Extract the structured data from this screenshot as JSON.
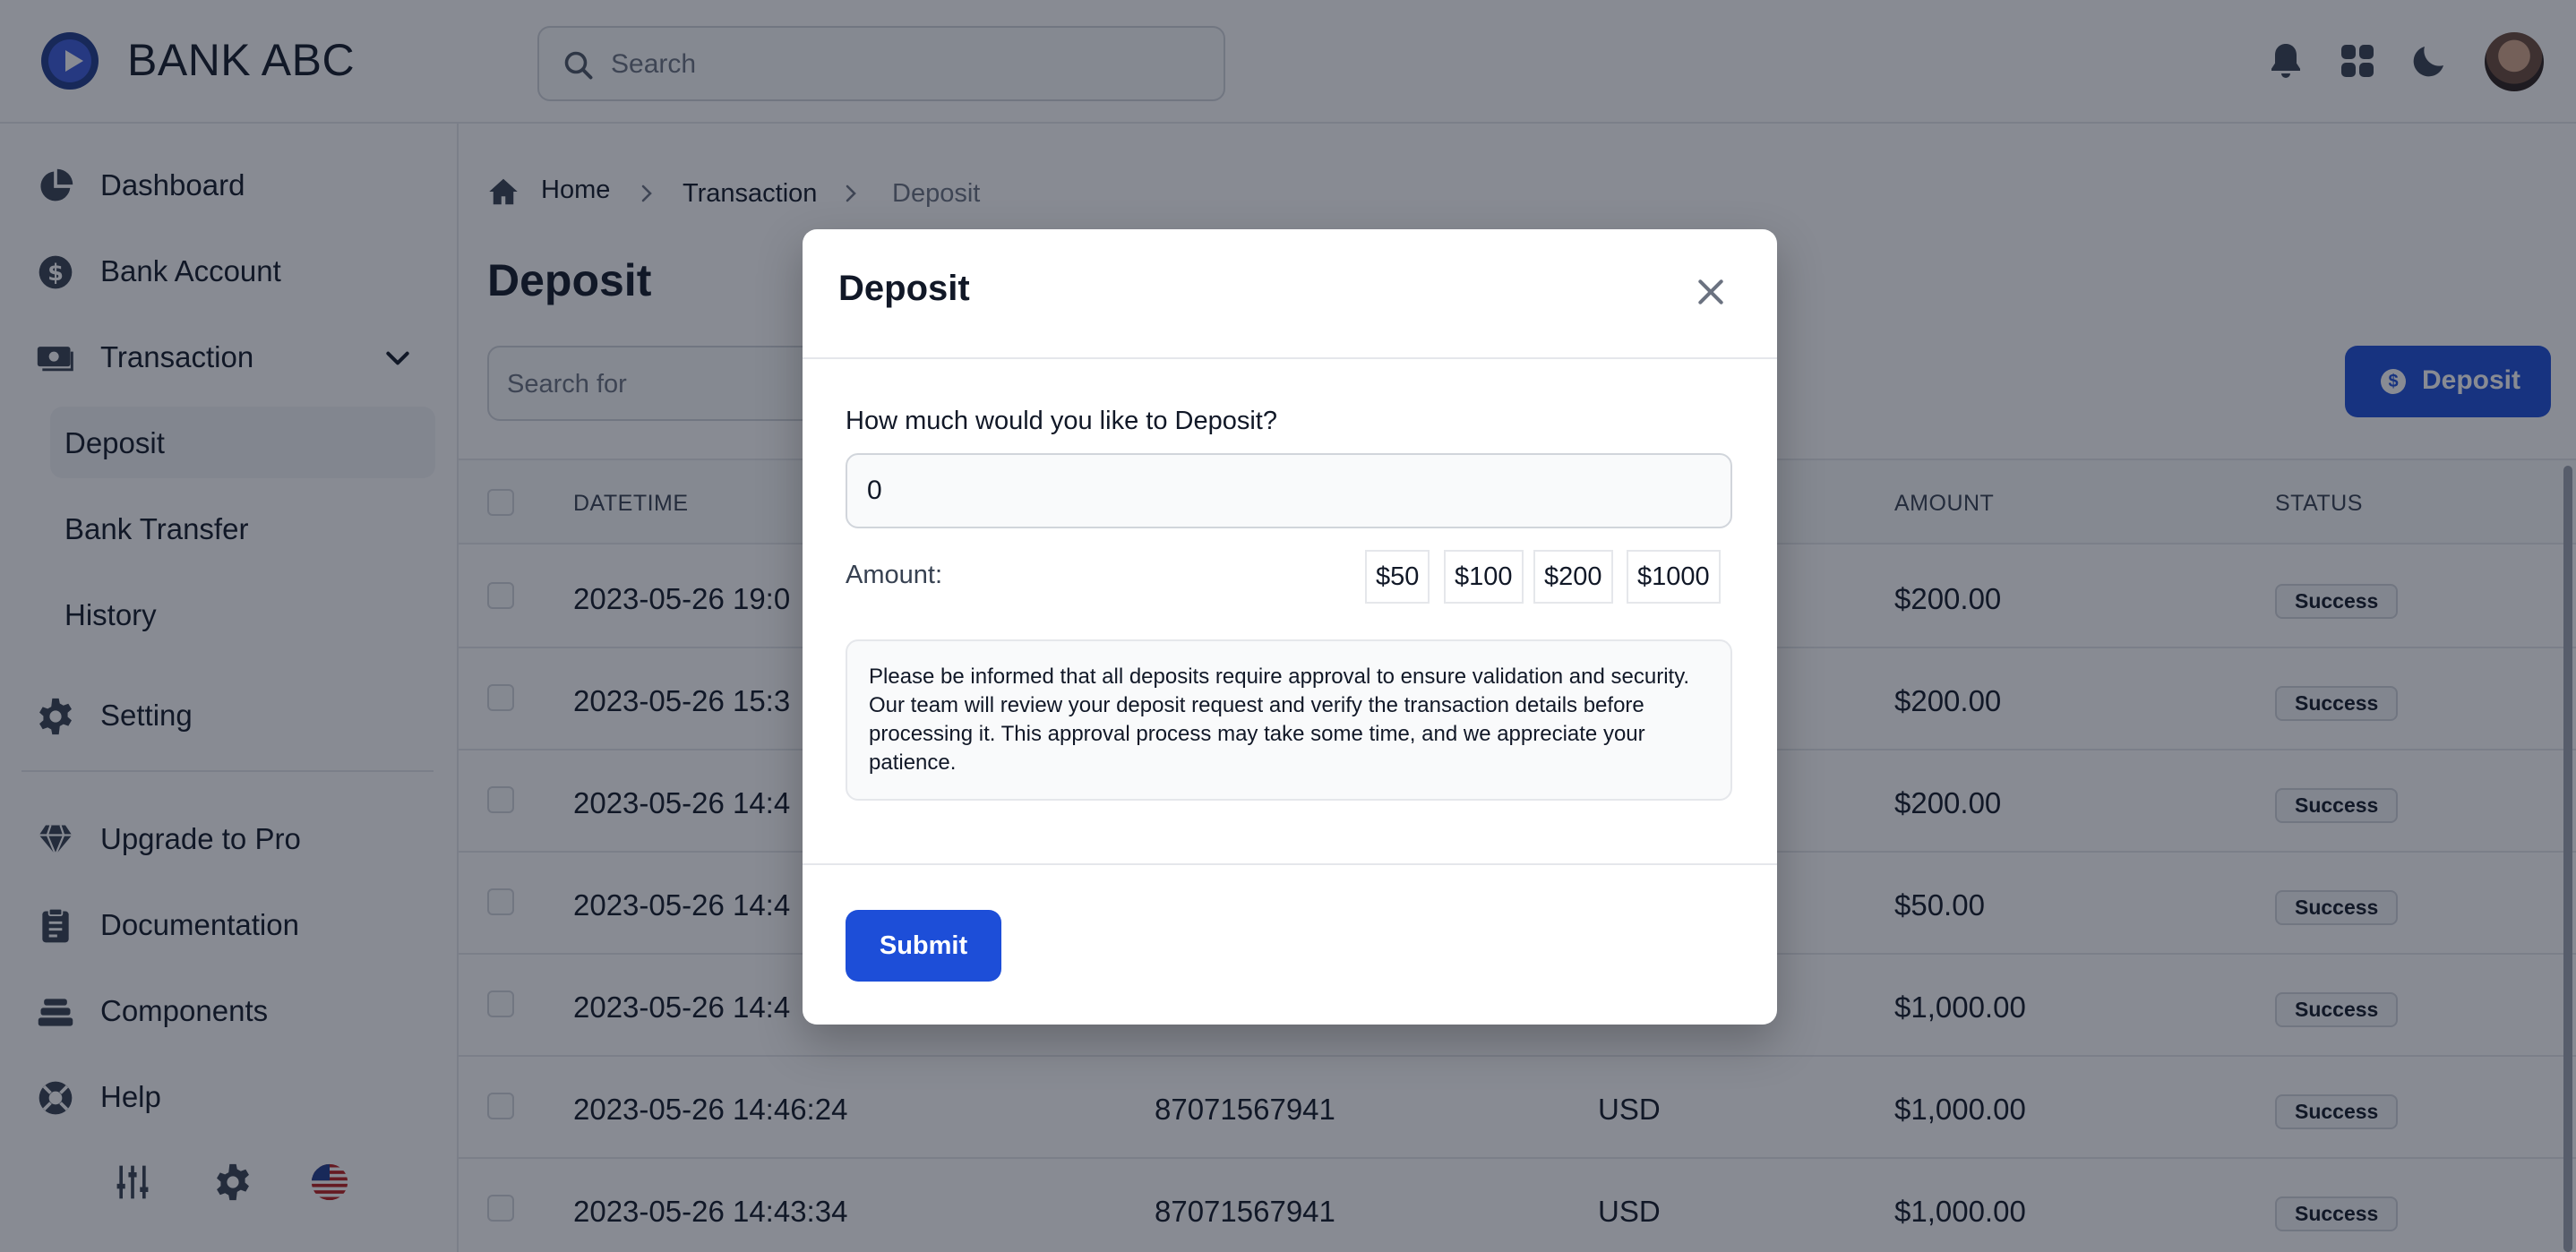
{
  "app": {
    "brand": "BANK ABC"
  },
  "header": {
    "search_placeholder": "Search",
    "icons": [
      "bell-icon",
      "apps-grid-icon",
      "moon-icon",
      "avatar"
    ]
  },
  "sidebar": {
    "items": [
      {
        "label": "Dashboard",
        "icon": "pie-chart-icon"
      },
      {
        "label": "Bank Account",
        "icon": "dollar-circle-icon"
      },
      {
        "label": "Transaction",
        "icon": "cash-icon",
        "expanded": true,
        "children": [
          {
            "label": "Deposit",
            "active": true
          },
          {
            "label": "Bank Transfer"
          },
          {
            "label": "History"
          }
        ]
      },
      {
        "label": "Setting",
        "icon": "gear-icon"
      },
      {
        "label": "Upgrade to Pro",
        "icon": "gem-icon"
      },
      {
        "label": "Documentation",
        "icon": "clipboard-icon"
      },
      {
        "label": "Components",
        "icon": "layers-icon"
      },
      {
        "label": "Help",
        "icon": "lifebuoy-icon"
      }
    ],
    "footer_icons": [
      "sliders-icon",
      "gear-icon",
      "us-flag-icon"
    ]
  },
  "breadcrumb": {
    "home": "Home",
    "section": "Transaction",
    "current": "Deposit"
  },
  "page": {
    "title": "Deposit",
    "search_placeholder": "Search for",
    "deposit_button": "Deposit",
    "accent": "#1d4ed8"
  },
  "table": {
    "headers": {
      "datetime": "DATETIME",
      "amount": "AMOUNT",
      "status": "STATUS"
    },
    "rows": [
      {
        "datetime": "2023-05-26 19:0",
        "account": "",
        "currency": "",
        "amount": "$200.00",
        "status": "Success"
      },
      {
        "datetime": "2023-05-26 15:3",
        "account": "",
        "currency": "",
        "amount": "$200.00",
        "status": "Success"
      },
      {
        "datetime": "2023-05-26 14:4",
        "account": "",
        "currency": "",
        "amount": "$200.00",
        "status": "Success"
      },
      {
        "datetime": "2023-05-26 14:4",
        "account": "",
        "currency": "",
        "amount": "$50.00",
        "status": "Success"
      },
      {
        "datetime": "2023-05-26 14:4",
        "account": "",
        "currency": "",
        "amount": "$1,000.00",
        "status": "Success"
      },
      {
        "datetime": "2023-05-26 14:46:24",
        "account": "87071567941",
        "currency": "USD",
        "amount": "$1,000.00",
        "status": "Success"
      },
      {
        "datetime": "2023-05-26 14:43:34",
        "account": "87071567941",
        "currency": "USD",
        "amount": "$1,000.00",
        "status": "Success"
      }
    ]
  },
  "modal": {
    "title": "Deposit",
    "question": "How much would you like to Deposit?",
    "amount_value": "0",
    "amount_label": "Amount:",
    "quick_amounts": [
      "$50",
      "$100",
      "$200",
      "$1000"
    ],
    "notice": "Please be informed that all deposits require approval to ensure validation and security. Our team will review your deposit request and verify the transaction details before processing it. This approval process may take some time, and we appreciate your patience.",
    "submit": "Submit"
  }
}
